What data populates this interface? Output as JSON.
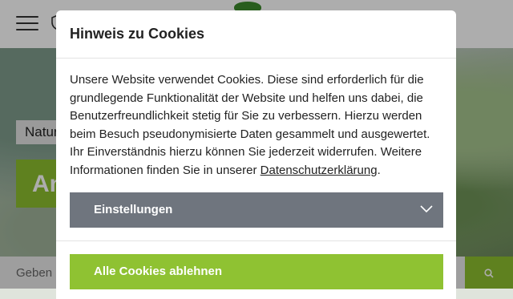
{
  "header": {
    "menu_icon": "hamburger-menu-icon",
    "shield_icon": "shield-icon",
    "logo_icon": "tree-logo-icon"
  },
  "hero": {
    "tag_label": "Natur",
    "title": "An"
  },
  "search": {
    "placeholder": "Geben Sie hier Ihren Suchbegriff ein",
    "button_icon": "search-icon"
  },
  "cookie_modal": {
    "title": "Hinweis zu Cookies",
    "body_text": "Unsere Website verwendet Cookies. Diese sind erforderlich für die grundlegende Funktionalität der Website und helfen uns dabei, die Benutzerfreundlichkeit stetig für Sie zu verbessern. Hierzu werden beim Besuch pseudonymisierte Daten gesammelt und ausgewertet. Ihr Einverständnis hierzu können Sie jederzeit widerrufen. Weitere Informationen finden Sie in unserer ",
    "privacy_link": "Datenschutzerklärung",
    "body_end": ".",
    "settings_label": "Einstellungen",
    "settings_icon": "chevron-down-icon",
    "reject_label": "Alle Cookies ablehnen"
  },
  "colors": {
    "accent_green": "#8fc232",
    "settings_gray": "#6f757e"
  }
}
